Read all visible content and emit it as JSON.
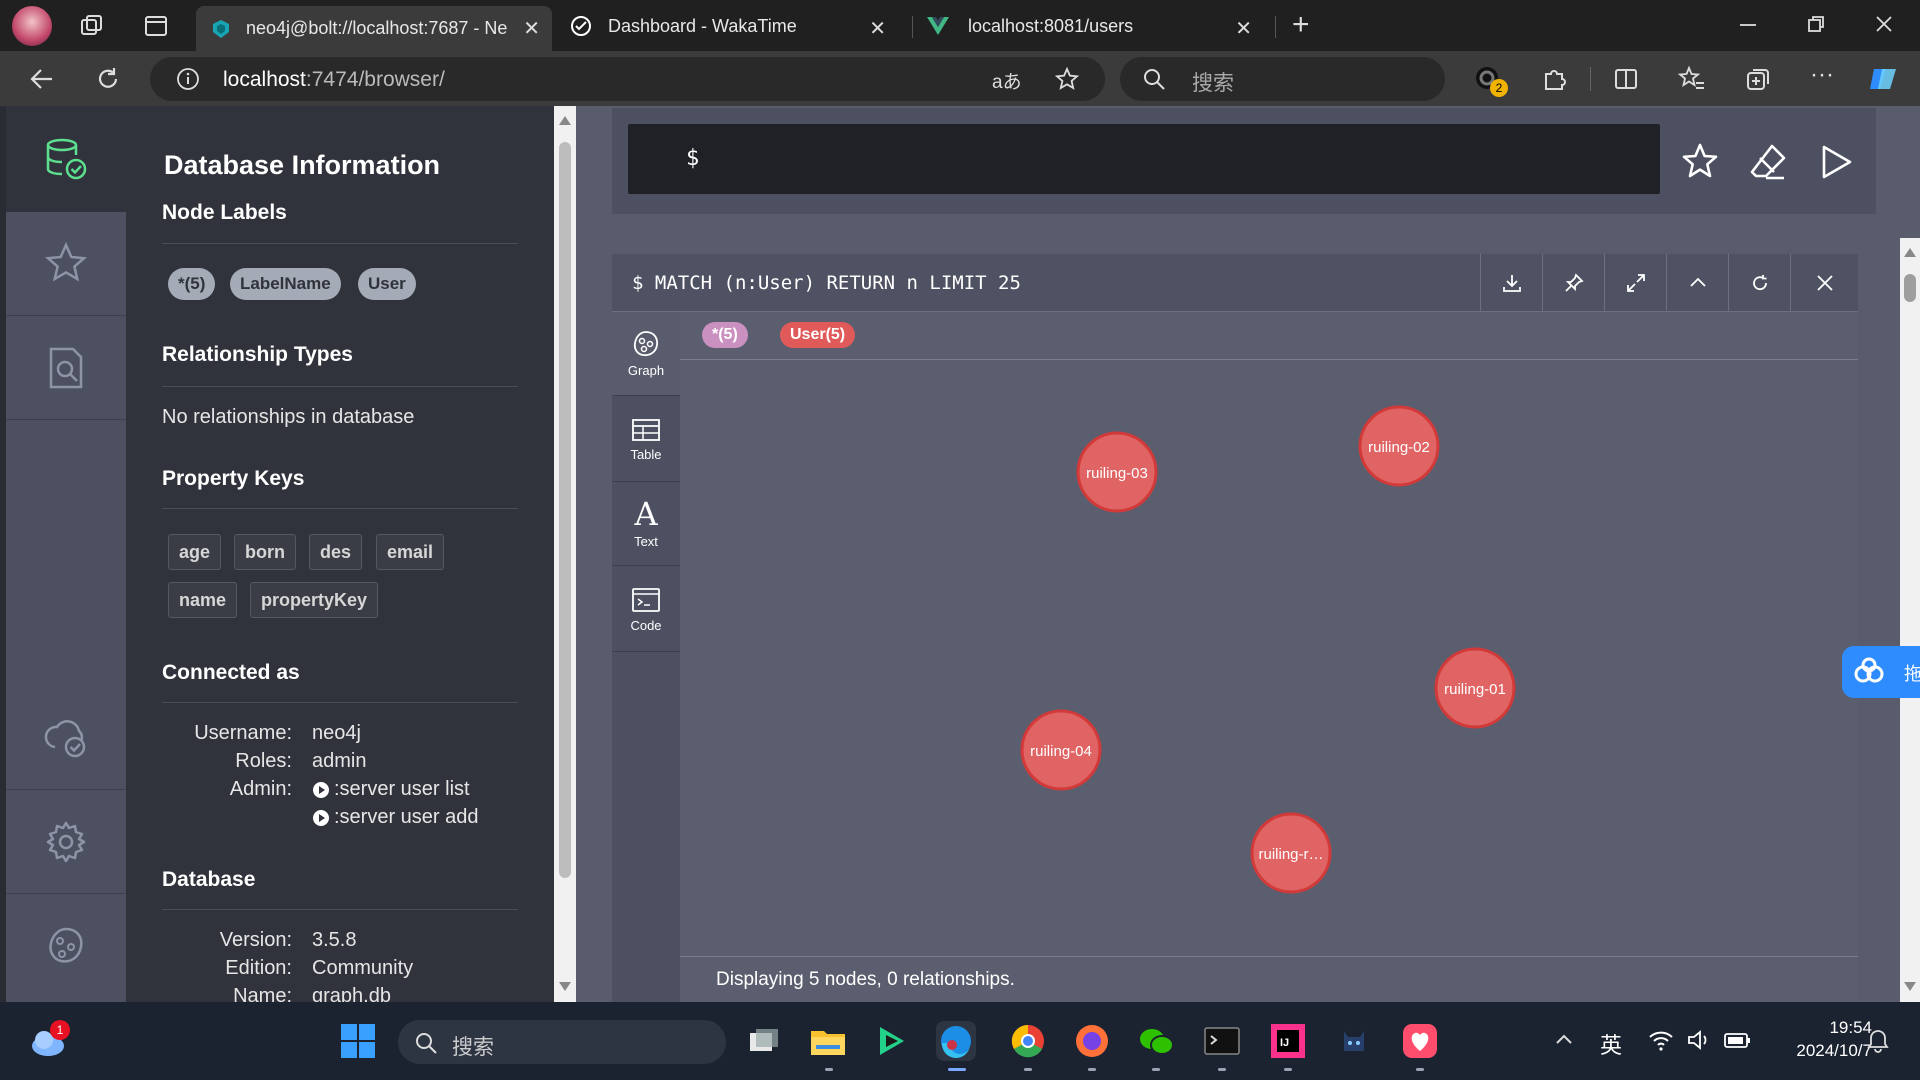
{
  "browser": {
    "tabs": [
      {
        "title": "neo4j@bolt://localhost:7687 - Ne",
        "active": true
      },
      {
        "title": "Dashboard - WakaTime",
        "active": false
      },
      {
        "title": "localhost:8081/users",
        "active": false
      }
    ],
    "address": {
      "host": "localhost",
      "rest": ":7474/browser/"
    },
    "search_placeholder": "搜索",
    "extension_badge": "2",
    "translate_glyph": "aあ"
  },
  "sidebar": {
    "items": [
      {
        "name": "database-icon",
        "active": true
      },
      {
        "name": "favorites-icon"
      },
      {
        "name": "documents-icon"
      },
      {
        "name": "sync-icon"
      },
      {
        "name": "settings-icon"
      },
      {
        "name": "about-icon"
      }
    ]
  },
  "drawer": {
    "title": "Database Information",
    "node_labels": {
      "heading": "Node Labels",
      "items": [
        "*(5)",
        "LabelName",
        "User"
      ]
    },
    "relationship_types": {
      "heading": "Relationship Types",
      "empty_text": "No relationships in database"
    },
    "property_keys": {
      "heading": "Property Keys",
      "items": [
        "age",
        "born",
        "des",
        "email",
        "name",
        "propertyKey"
      ]
    },
    "connected_as": {
      "heading": "Connected as",
      "username_label": "Username:",
      "username": "neo4j",
      "roles_label": "Roles:",
      "roles": "admin",
      "admin_label": "Admin:",
      "admin_links": [
        ":server user list",
        ":server user add"
      ]
    },
    "database": {
      "heading": "Database",
      "version_label": "Version:",
      "version": "3.5.8",
      "edition_label": "Edition:",
      "edition": "Community",
      "name_label": "Name:",
      "name": "graph.db"
    }
  },
  "editor": {
    "prompt": "$"
  },
  "frame": {
    "query": "$ MATCH (n:User) RETURN n LIMIT 25",
    "views": [
      {
        "label": "Graph",
        "icon": "graph-icon",
        "active": true
      },
      {
        "label": "Table",
        "icon": "table-icon"
      },
      {
        "label": "Text",
        "icon": "text-icon"
      },
      {
        "label": "Code",
        "icon": "code-icon"
      }
    ],
    "legend": [
      {
        "label": "*(5)",
        "color": "#c990c0"
      },
      {
        "label": "User(5)",
        "color": "#e05a5a"
      }
    ],
    "nodes": [
      "ruiling-03",
      "ruiling-02",
      "ruiling-01",
      "ruiling-04",
      "ruiling-r…"
    ],
    "status": "Displaying 5 nodes, 0 relationships."
  },
  "taskbar": {
    "search_placeholder": "搜索",
    "weather_badge": "1",
    "ime": "英",
    "time": "19:54",
    "date": "2024/10/7"
  },
  "float_button_glyph": "拖"
}
